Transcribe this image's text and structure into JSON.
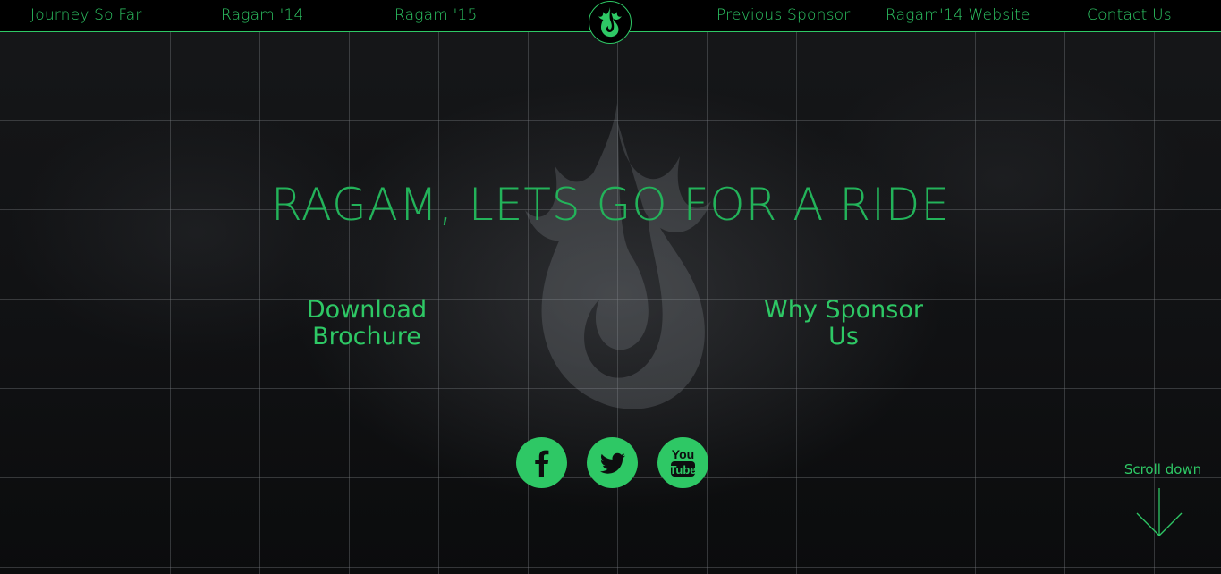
{
  "nav": {
    "items": [
      {
        "label": "Journey So Far"
      },
      {
        "label": "Ragam '14"
      },
      {
        "label": "Ragam '15"
      },
      {
        "label": "Previous Sponsor"
      },
      {
        "label": "Ragam'14 Website"
      },
      {
        "label": "Contact Us"
      }
    ],
    "logo_icon": "flame-logo-icon"
  },
  "hero": {
    "headline": "RAGAM, LETS GO FOR A RIDE",
    "download_line1": "Download",
    "download_line2": "Brochure",
    "why_line1": "Why Sponsor",
    "why_line2": "Us"
  },
  "social": [
    {
      "icon": "facebook-icon"
    },
    {
      "icon": "twitter-icon"
    },
    {
      "icon": "youtube-icon",
      "text_top": "You",
      "text_bottom": "Tube"
    }
  ],
  "scroll": {
    "label": "Scroll down",
    "icon": "arrow-down-icon"
  },
  "colors": {
    "accent": "#2ec865",
    "headline": "#23b35a",
    "nav_bg": "#000000",
    "background": "#101113"
  }
}
